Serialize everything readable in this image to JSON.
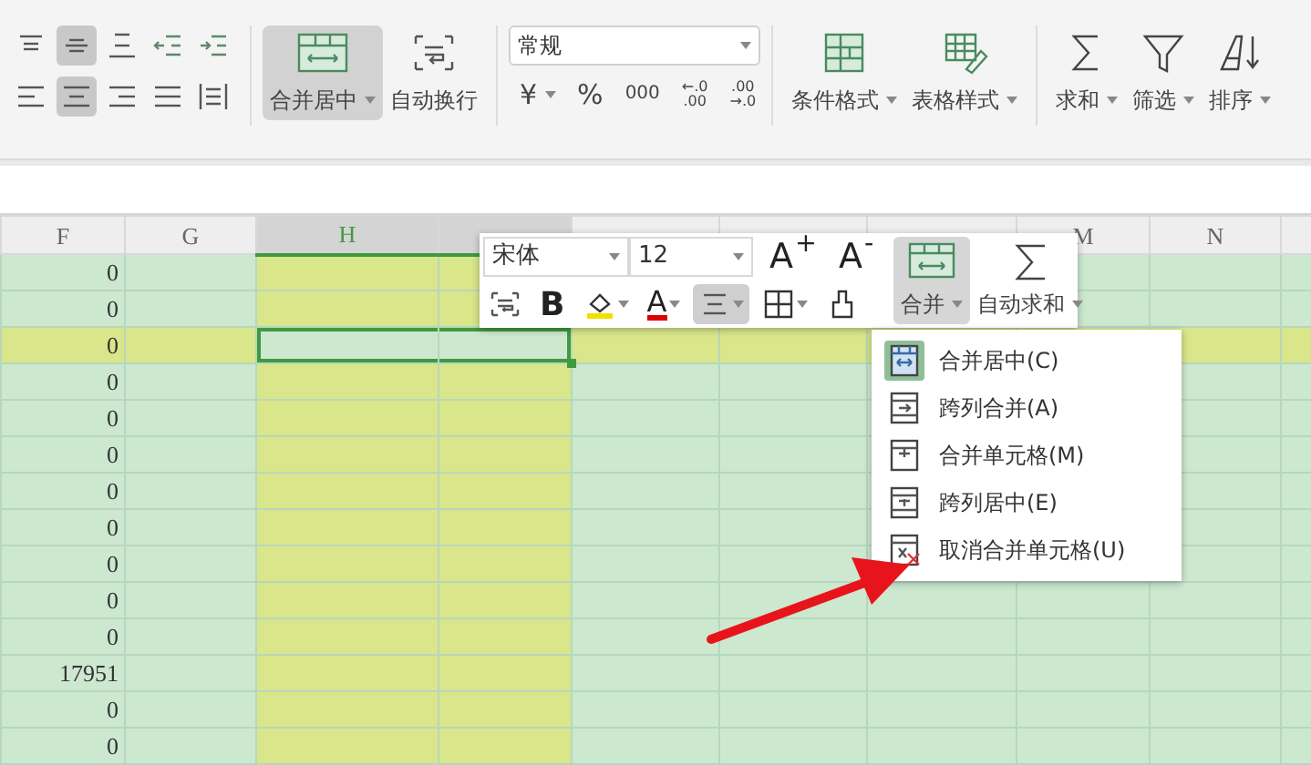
{
  "ribbon": {
    "align_buttons": [
      {
        "kind": "top",
        "selected": false
      },
      {
        "kind": "middle",
        "selected": true
      },
      {
        "kind": "bottom",
        "selected": false
      },
      {
        "kind": "outdent",
        "selected": false
      },
      {
        "kind": "indent",
        "selected": false
      },
      {
        "kind": "left",
        "selected": false
      },
      {
        "kind": "center",
        "selected": true
      },
      {
        "kind": "right",
        "selected": false
      },
      {
        "kind": "justify",
        "selected": false
      },
      {
        "kind": "distribute",
        "selected": false
      }
    ],
    "merge_center_button": {
      "label": "合并居中",
      "selected": true
    },
    "wrap_button": {
      "label": "自动换行"
    },
    "number_format": {
      "value": "常规"
    },
    "number_buttons": [
      {
        "kind": "currency",
        "label": "¥"
      },
      {
        "kind": "percent",
        "label": "%"
      },
      {
        "kind": "thousands",
        "label": "000"
      },
      {
        "kind": "decimal",
        "label": "←.0",
        "sub": ".00"
      },
      {
        "kind": "decimal",
        "label": ".00",
        "sub": "→.0"
      }
    ],
    "big_buttons": [
      {
        "kind": "conditional",
        "label": "条件格式"
      },
      {
        "kind": "table-style",
        "label": "表格样式"
      },
      {
        "kind": "sum",
        "label": "求和"
      },
      {
        "kind": "filter",
        "label": "筛选"
      },
      {
        "kind": "sort",
        "label": "排序"
      }
    ]
  },
  "sheet": {
    "columns": [
      {
        "label": "F",
        "selected": false
      },
      {
        "label": "G",
        "selected": false
      },
      {
        "label": "H",
        "selected": true
      },
      {
        "selected": true
      },
      {
        "selected": false
      },
      {
        "selected": false
      },
      {
        "selected": false
      },
      {
        "label": "M",
        "selected": false
      },
      {
        "label": "N",
        "selected": false
      },
      {
        "selected": false
      }
    ],
    "rows": [
      {
        "value": "0",
        "selected": false
      },
      {
        "value": "0",
        "selected": false
      },
      {
        "value": "0",
        "selected": true
      },
      {
        "value": "0",
        "selected": false
      },
      {
        "value": "0",
        "selected": false
      },
      {
        "value": "0",
        "selected": false
      },
      {
        "value": "0",
        "selected": false
      },
      {
        "value": "0",
        "selected": false
      },
      {
        "value": "0",
        "selected": false
      },
      {
        "value": "0",
        "selected": false
      },
      {
        "value": "0",
        "selected": false
      },
      {
        "value": "17951",
        "selected": false
      },
      {
        "value": "0",
        "selected": false
      },
      {
        "value": "0",
        "selected": false
      }
    ]
  },
  "mini_toolbar": {
    "font": "宋体",
    "size": "12",
    "size_buttons": [
      "A$^{+}$",
      "A$^{-}$"
    ],
    "tools": [
      {
        "kind": "wrap",
        "selected": false
      },
      {
        "kind": "bold",
        "label": "B",
        "selected": false
      },
      {
        "kind": "fill",
        "selected": false
      },
      {
        "kind": "font-color",
        "label": "A",
        "selected": false
      },
      {
        "kind": "align",
        "selected": true
      },
      {
        "kind": "border",
        "selected": false
      },
      {
        "kind": "painter",
        "selected": false
      }
    ],
    "merge_button": {
      "label": "合并",
      "selected": true
    },
    "autosum_button": {
      "label": "自动求和"
    }
  },
  "merge_menu": [
    {
      "kind": "merge-center",
      "label": "合并居中(C)",
      "selected": true
    },
    {
      "kind": "merge-across",
      "label": "跨列合并(A)",
      "selected": false
    },
    {
      "kind": "merge-cells",
      "label": "合并单元格(M)",
      "selected": false
    },
    {
      "kind": "center-across",
      "label": "跨列居中(E)",
      "selected": false
    },
    {
      "kind": "unmerge",
      "label": "取消合并单元格(U)",
      "selected": false
    }
  ]
}
